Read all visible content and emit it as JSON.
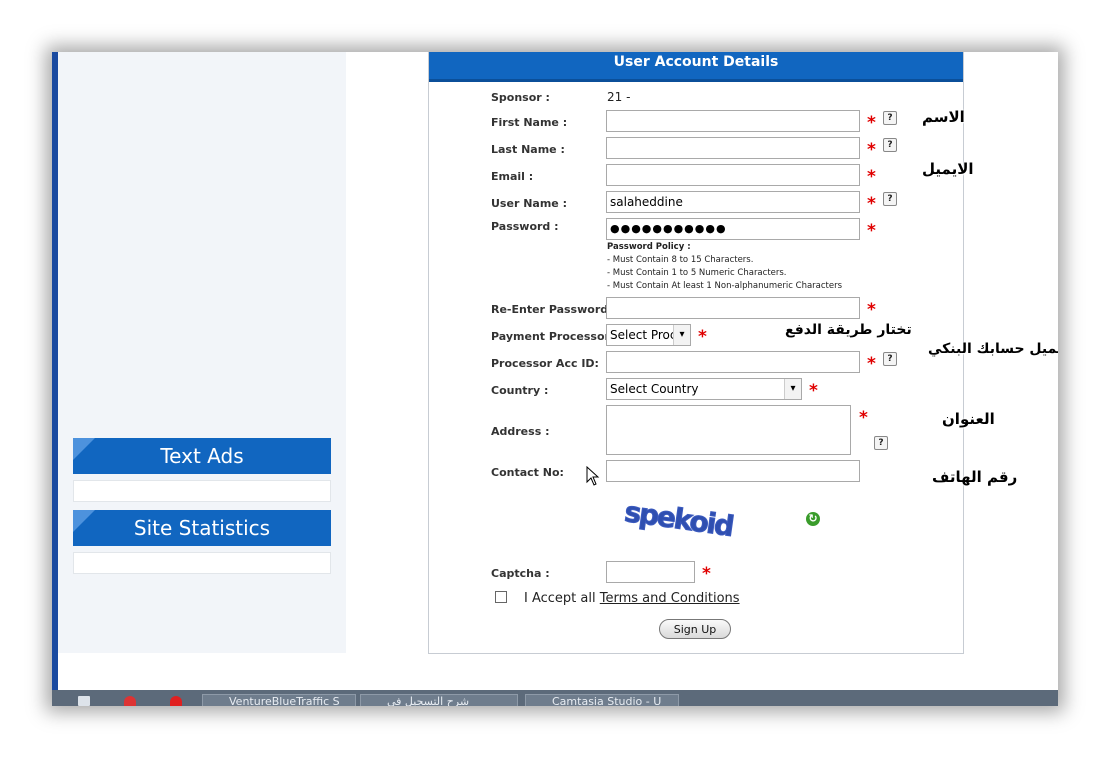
{
  "sidebar": {
    "widgets": [
      {
        "title": "Text Ads"
      },
      {
        "title": "Site Statistics"
      }
    ]
  },
  "form": {
    "title": "User Account Details",
    "sponsor_label": "Sponsor :",
    "sponsor_value": "21 -",
    "first_name_label": "First Name :",
    "first_name_value": "",
    "last_name_label": "Last Name :",
    "last_name_value": "",
    "email_label": "Email :",
    "email_value": "",
    "username_label": "User Name :",
    "username_value": "salaheddine",
    "password_label": "Password :",
    "password_value": "●●●●●●●●●●●",
    "policy_title": "Password Policy :",
    "policy_lines": [
      "- Must Contain 8 to 15 Characters.",
      "- Must Contain 1 to 5 Numeric Characters.",
      "- Must Contain At least 1 Non-alphanumeric Characters"
    ],
    "reenter_label": "Re-Enter Password :",
    "processor_label": "Payment Processor :",
    "processor_value": "Select Proc",
    "processor_acc_label": "Processor Acc ID:",
    "country_label": "Country :",
    "country_value": "Select Country",
    "address_label": "Address :",
    "contact_label": "Contact No:",
    "captcha_text": "spekoid",
    "captcha_label": "Captcha :",
    "accept_text": "I Accept all",
    "terms_link": "Terms and Conditions",
    "signup_label": "Sign Up",
    "required_mark": "*",
    "help_mark": "?"
  },
  "annotations": {
    "name": "الاسم",
    "email": "الايميل",
    "payment": "تختار طريقة الدفع",
    "bank_email": "تضع ايميل حسابك البنكي",
    "address": "العنوان",
    "phone": "رقم الهاتف"
  },
  "taskbar": {
    "items": [
      {
        "label": "VentureBlueTraffic S"
      },
      {
        "label": "شرح التسجيل في"
      },
      {
        "label": "Camtasia Studio - U"
      }
    ]
  },
  "colors": {
    "header_blue": "#1166c0",
    "required_red": "#e00000",
    "sidebar_bg": "#f2f5f9"
  }
}
